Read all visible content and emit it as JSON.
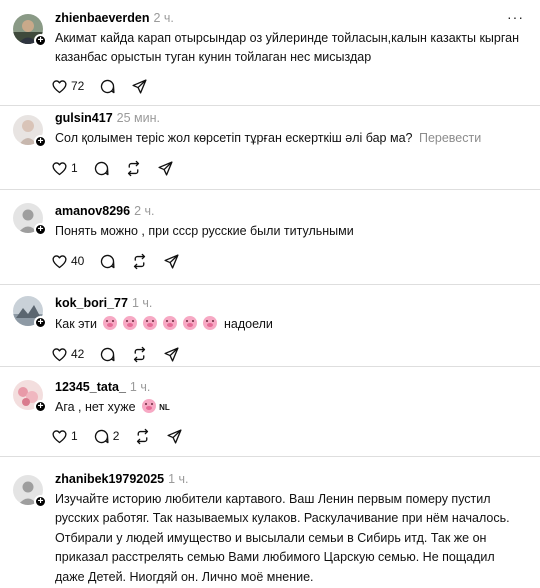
{
  "comments": [
    {
      "username": "zhienbaeverden",
      "time": "2 ч.",
      "text": "Акимат кайда карап отырсындар оз уйлеринде тойласын,калын казакты кырган казанбас орыстын туган кунин тойлаган нес мисыздар",
      "likes": "72",
      "replies": "",
      "more": "···",
      "avatar_icon": "profile-photo"
    },
    {
      "username": "gulsin417",
      "time": "25 мин.",
      "text": "Сол қолымен теріс жол көрсетіп тұрған ескерткіш әлі бар ма?",
      "translate": "Перевести",
      "likes": "1",
      "replies": "",
      "avatar_icon": "profile-photo"
    },
    {
      "username": "amanov8296",
      "time": "2 ч.",
      "text": "Понять можно , при ссср русские были титульными",
      "likes": "40",
      "replies": "",
      "avatar_icon": "default-avatar"
    },
    {
      "username": "kok_bori_77",
      "time": "1 ч.",
      "text_before": "Как эти",
      "emoji_icon": "pig-face-icon",
      "text_after": "надоели",
      "likes": "42",
      "replies": "",
      "avatar_icon": "profile-photo"
    },
    {
      "username": "12345_tata_",
      "time": "1 ч.",
      "text_before": "Ага , нет хуже",
      "flag_text": "NL",
      "likes": "1",
      "replies": "2",
      "avatar_icon": "profile-photo"
    },
    {
      "username": "zhanibek19792025",
      "time": "1 ч.",
      "text": "Изучайте историю любители картавого. Ваш Ленин первым померу пустил русских работяг. Так называемых кулаков. Раскулачивание при нём началось. Отбирали у людей имущество и высылали семьи в Сибирь итд. Так же он приказал расстрелять семью Вами любимого Царскую семью. Не пощадил даже Детей. Ниогдяй он. Лично моё мнение.",
      "avatar_icon": "default-avatar"
    }
  ],
  "icons": {
    "like": "heart-icon",
    "reply": "comment-icon",
    "repost": "repost-icon",
    "share": "share-icon",
    "follow": "plus-icon"
  },
  "colors": {
    "time": "#9a9a9a",
    "translate": "#8c8c8c",
    "divider": "#dedede"
  }
}
